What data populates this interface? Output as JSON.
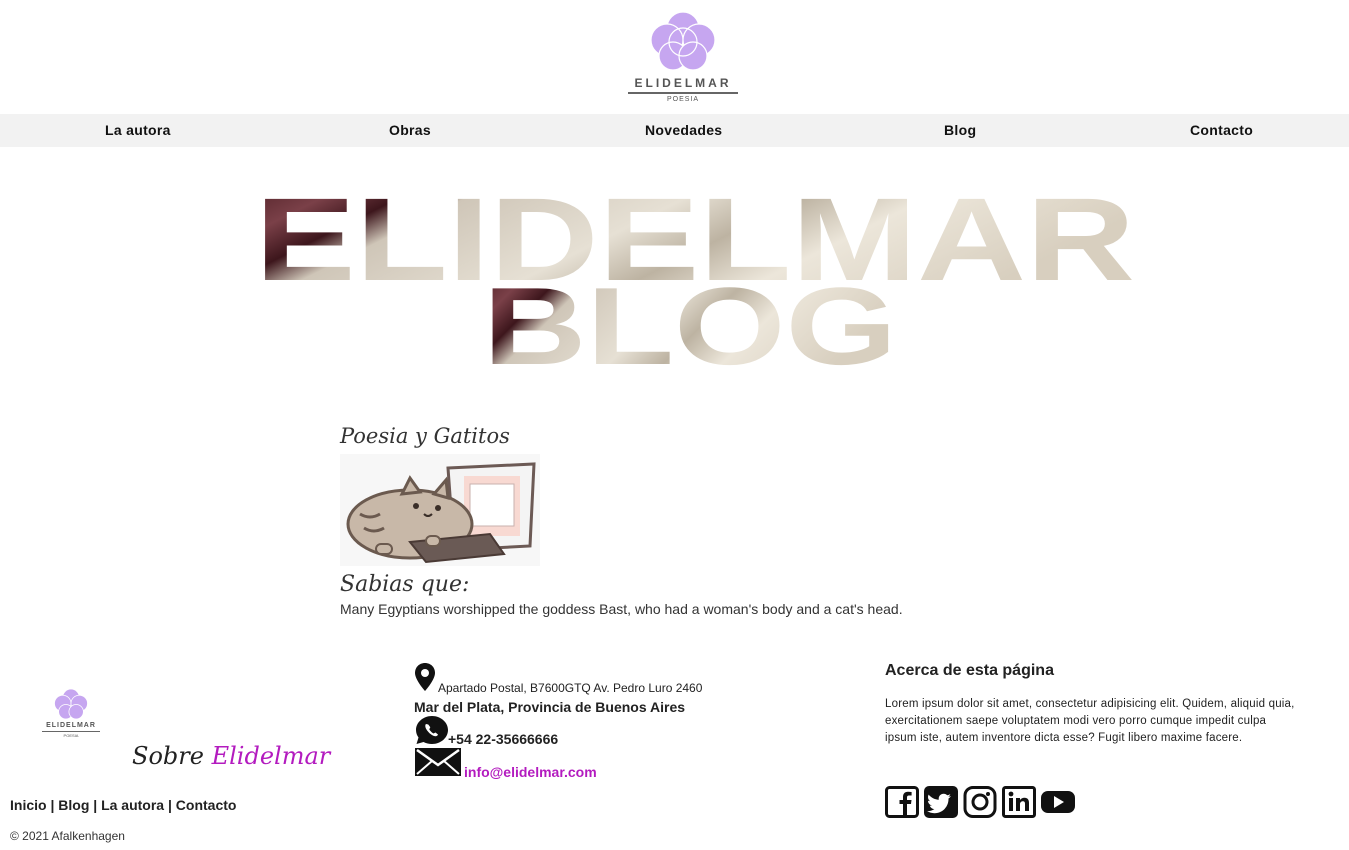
{
  "header": {
    "logo_brand": "ELIDELMAR",
    "logo_sub": "POESIA"
  },
  "nav": {
    "items": [
      "La autora",
      "Obras",
      "Novedades",
      "Blog",
      "Contacto"
    ]
  },
  "hero": {
    "line1": "ELIDELMAR",
    "line2": "BLOG"
  },
  "post": {
    "title": "Poesia y Gatitos",
    "image_icon": "cat-laptop-image",
    "subtitle": "Sabias que:",
    "text": "Many Egyptians worshipped the goddess Bast, who had a woman's body and a cat's head."
  },
  "footer": {
    "logo_brand": "ELIDELMAR",
    "logo_sub": "POESIA",
    "sobre_prefix": "Sobre",
    "sobre_highlight": "Elidelmar",
    "links": [
      "Inicio",
      "Blog",
      "La autora",
      "Contacto"
    ],
    "link_separator": "|",
    "copyright": "© 2021 Afalkenhagen",
    "contact": {
      "address_line1": "Apartado Postal, B7600GTQ Av. Pedro Luro 2460",
      "address_line2": "Mar del Plata, Provincia de Buenos Aires",
      "phone": "+54 22-35666666",
      "email": "info@elidelmar.com"
    },
    "about": {
      "heading": "Acerca de esta página",
      "text": "Lorem ipsum dolor sit amet, consectetur adipisicing elit. Quidem, aliquid quia, exercitationem saepe voluptatem modi vero porro cumque impedit culpa ipsum iste, autem inventore dicta esse? Fugit libero maxime facere."
    },
    "social": [
      "facebook-icon",
      "twitter-icon",
      "instagram-icon",
      "linkedin-icon",
      "youtube-icon"
    ]
  },
  "colors": {
    "accent": "#b31bbf",
    "logo_petal": "#c6a6f0",
    "nav_bg": "#f2f2f2"
  }
}
